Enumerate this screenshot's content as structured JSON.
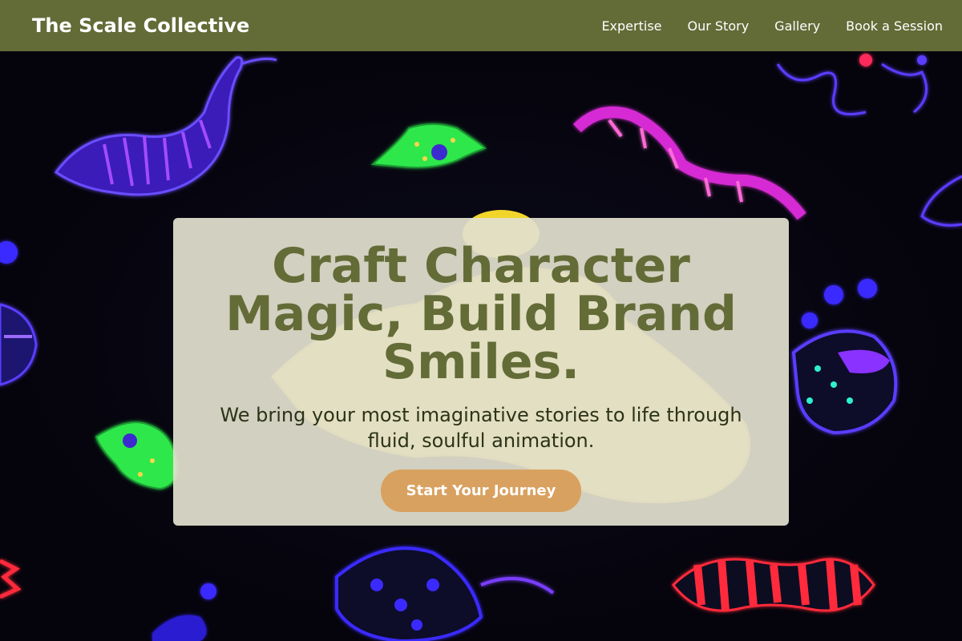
{
  "header": {
    "brand": "The Scale Collective",
    "nav": [
      {
        "label": "Expertise"
      },
      {
        "label": "Our Story"
      },
      {
        "label": "Gallery"
      },
      {
        "label": "Book a Session"
      }
    ]
  },
  "hero": {
    "headline": "Craft Character Magic, Build Brand Smiles.",
    "subtitle": "We bring your most imaginative stories to life through fluid, soulful animation.",
    "cta_label": "Start Your Journey",
    "background_image": "glowing neon creature drawings on black"
  },
  "colors": {
    "header_bg": "#636b37",
    "headline": "#636b37",
    "cta_bg": "#d9a15f",
    "card_bg": "#e2e0cd"
  }
}
